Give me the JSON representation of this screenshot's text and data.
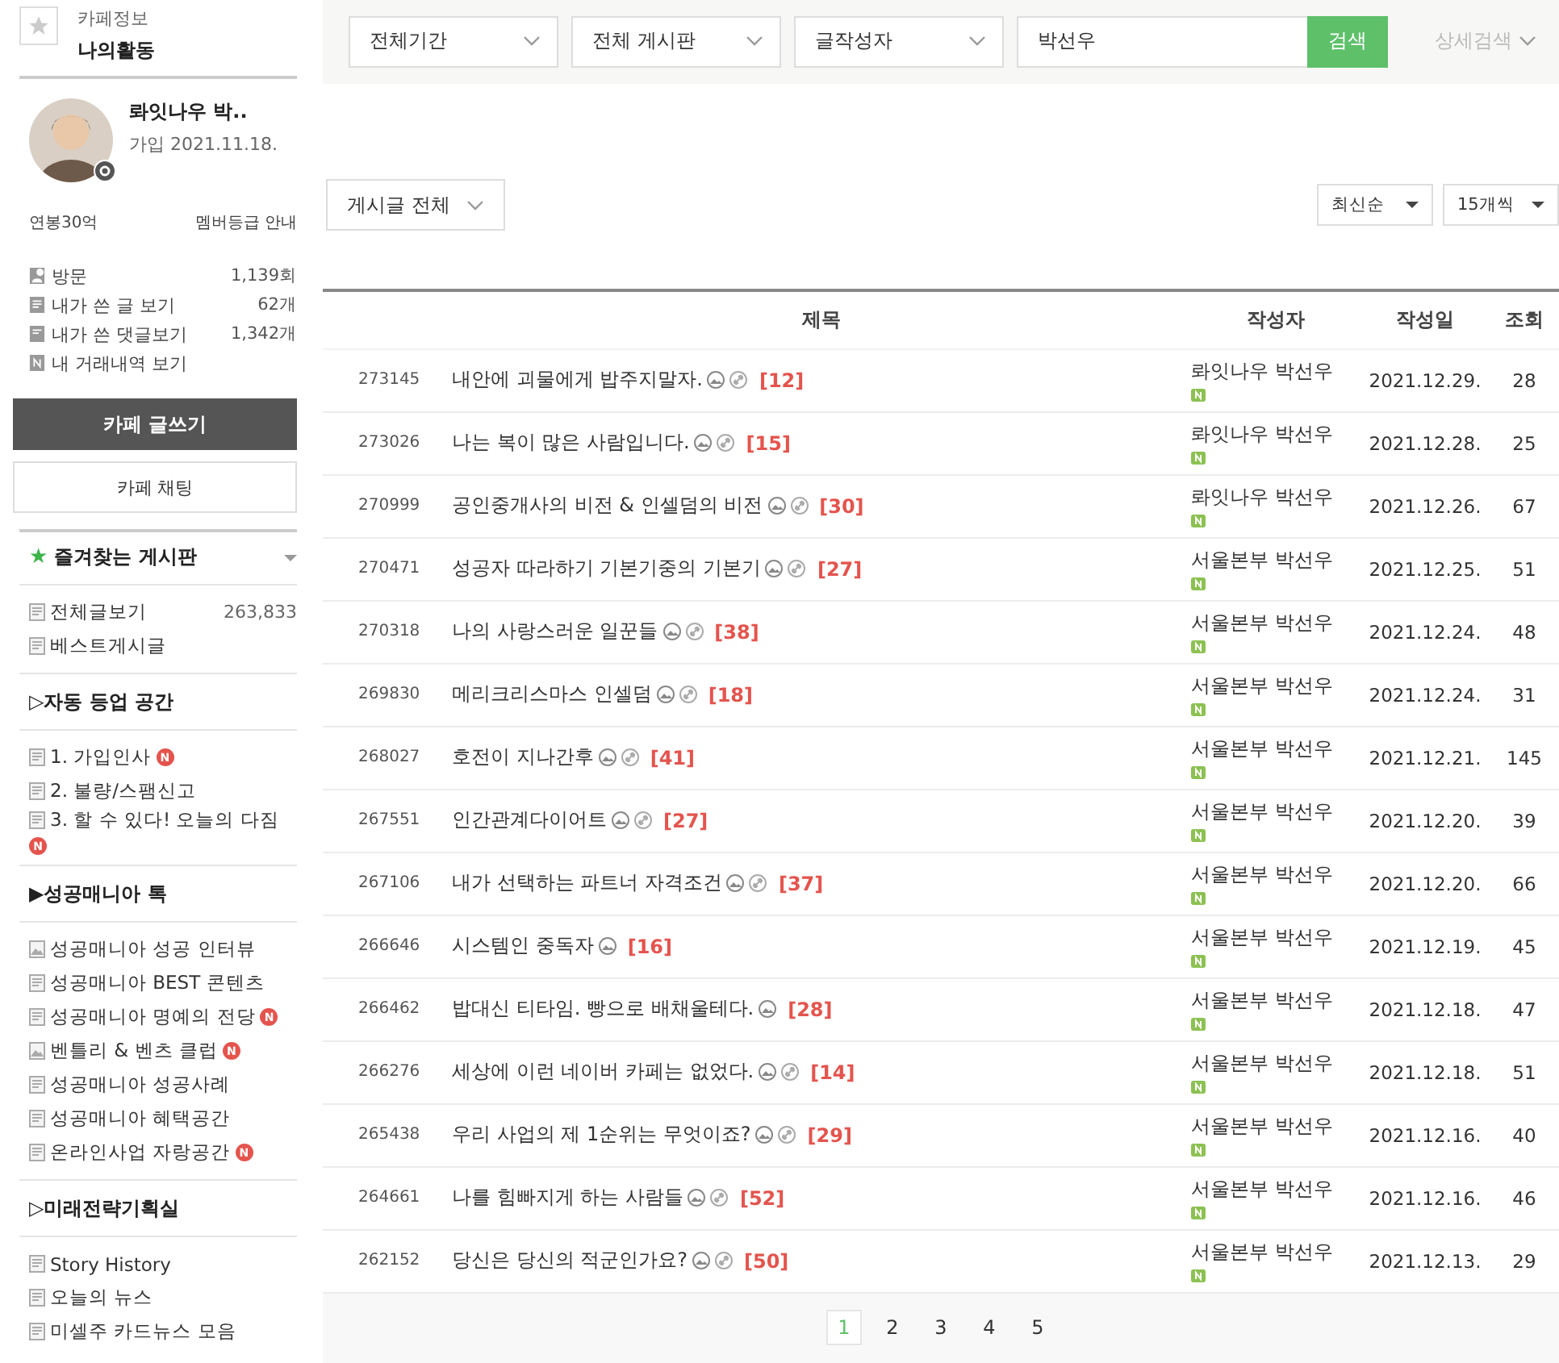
{
  "sidebar": {
    "cafe_info": "카페정보",
    "my_activity": "나의활동",
    "profile": {
      "nickname": "롸잇나우 박..",
      "joined": "가입 2021.11.18.",
      "grade": "연봉30억",
      "grade_guide": "멤버등급 안내"
    },
    "stats": [
      {
        "kind": "visit",
        "label": "방문",
        "value": "1,139회"
      },
      {
        "kind": "post",
        "label": "내가 쓴 글 보기",
        "value": "62개"
      },
      {
        "kind": "comment",
        "label": "내가 쓴 댓글보기",
        "value": "1,342개"
      },
      {
        "kind": "trade",
        "label": "내 거래내역 보기"
      }
    ],
    "write_button": "카페 글쓰기",
    "chat_button": "카페 채팅",
    "favorites": {
      "star": "★",
      "title": "즐겨찾는 게시판"
    },
    "sections": [
      {
        "items": [
          {
            "kind": "doc",
            "label": "전체글보기",
            "count": "263,833",
            "new": false
          },
          {
            "kind": "doc",
            "label": "베스트게시글",
            "new": false
          }
        ]
      },
      {
        "title": "▷자동 등업 공간",
        "items": [
          {
            "kind": "doc",
            "label": "1. 가입인사",
            "new": true,
            "badge": "N"
          },
          {
            "kind": "doc",
            "label": "2. 불량/스팸신고",
            "new": false
          },
          {
            "kind": "doc",
            "label": "3. 할 수 있다! 오늘의 다짐",
            "new": true,
            "badge": "N"
          }
        ]
      },
      {
        "title": "▶성공매니아 톡",
        "items": [
          {
            "kind": "image",
            "label": "성공매니아 성공 인터뷰",
            "new": false
          },
          {
            "kind": "doc",
            "label": "성공매니아 BEST 콘텐츠",
            "new": false
          },
          {
            "kind": "doc",
            "label": "성공매니아 명예의 전당",
            "new": true,
            "badge": "N"
          },
          {
            "kind": "image",
            "label": "벤틀리 & 벤츠 클럽",
            "new": true,
            "badge": "N"
          },
          {
            "kind": "doc",
            "label": "성공매니아 성공사례",
            "new": false
          },
          {
            "kind": "doc",
            "label": "성공매니아 혜택공간",
            "new": false
          },
          {
            "kind": "doc",
            "label": "온라인사업 자랑공간",
            "new": true,
            "badge": "N"
          }
        ]
      },
      {
        "title": "▷미래전략기획실",
        "items": [
          {
            "kind": "doc",
            "label": "Story History",
            "new": false
          },
          {
            "kind": "doc",
            "label": "오늘의 뉴스",
            "new": false
          },
          {
            "kind": "doc",
            "label": "미셀주 카드뉴스 모음",
            "new": false
          }
        ]
      }
    ]
  },
  "search": {
    "period": "전체기간",
    "board": "전체 게시판",
    "type": "글작성자",
    "value": "박선우",
    "button": "검색",
    "advanced": "상세검색"
  },
  "filter": "게시글 전체",
  "sort": "최신순",
  "per_page": "15개씩",
  "table": {
    "columns": [
      "제목",
      "작성자",
      "작성일",
      "조회"
    ],
    "rows": [
      {
        "id": "273145",
        "title": "내안에 괴물에게 밥주지말자.",
        "link": true,
        "comments": "[12]",
        "author": "롸잇나우 박선우",
        "date": "2021.12.29.",
        "views": "28"
      },
      {
        "id": "273026",
        "title": "나는 복이 많은 사람입니다.",
        "link": true,
        "comments": "[15]",
        "author": "롸잇나우 박선우",
        "date": "2021.12.28.",
        "views": "25"
      },
      {
        "id": "270999",
        "title": "공인중개사의 비전 & 인셀덤의 비전",
        "link": true,
        "comments": "[30]",
        "author": "롸잇나우 박선우",
        "date": "2021.12.26.",
        "views": "67"
      },
      {
        "id": "270471",
        "title": "성공자 따라하기 기본기중의 기본기",
        "link": true,
        "comments": "[27]",
        "author": "서울본부 박선우",
        "date": "2021.12.25.",
        "views": "51"
      },
      {
        "id": "270318",
        "title": "나의 사랑스러운 일꾼들",
        "link": true,
        "comments": "[38]",
        "author": "서울본부 박선우",
        "date": "2021.12.24.",
        "views": "48"
      },
      {
        "id": "269830",
        "title": "메리크리스마스 인셀덤",
        "link": true,
        "comments": "[18]",
        "author": "서울본부 박선우",
        "date": "2021.12.24.",
        "views": "31"
      },
      {
        "id": "268027",
        "title": "호전이 지나간후",
        "link": true,
        "comments": "[41]",
        "author": "서울본부 박선우",
        "date": "2021.12.21.",
        "views": "145"
      },
      {
        "id": "267551",
        "title": "인간관계다이어트",
        "link": true,
        "comments": "[27]",
        "author": "서울본부 박선우",
        "date": "2021.12.20.",
        "views": "39"
      },
      {
        "id": "267106",
        "title": "내가 선택하는 파트너 자격조건",
        "link": true,
        "comments": "[37]",
        "author": "서울본부 박선우",
        "date": "2021.12.20.",
        "views": "66"
      },
      {
        "id": "266646",
        "title": "시스템인 중독자",
        "link": false,
        "comments": "[16]",
        "author": "서울본부 박선우",
        "date": "2021.12.19.",
        "views": "45"
      },
      {
        "id": "266462",
        "title": "밥대신 티타임. 빵으로 배채울테다.",
        "link": false,
        "comments": "[28]",
        "author": "서울본부 박선우",
        "date": "2021.12.18.",
        "views": "47"
      },
      {
        "id": "266276",
        "title": "세상에 이런 네이버 카페는 없었다.",
        "link": true,
        "comments": "[14]",
        "author": "서울본부 박선우",
        "date": "2021.12.18.",
        "views": "51"
      },
      {
        "id": "265438",
        "title": "우리 사업의 제 1순위는 무엇이죠?",
        "link": true,
        "comments": "[29]",
        "author": "서울본부 박선우",
        "date": "2021.12.16.",
        "views": "40"
      },
      {
        "id": "264661",
        "title": "나를 힘빠지게 하는 사람들",
        "link": true,
        "comments": "[52]",
        "author": "서울본부 박선우",
        "date": "2021.12.16.",
        "views": "46"
      },
      {
        "id": "262152",
        "title": "당신은 당신의 적군인가요?",
        "link": true,
        "comments": "[50]",
        "author": "서울본부 박선우",
        "date": "2021.12.13.",
        "views": "29"
      }
    ]
  },
  "pagination": [
    {
      "label": "1",
      "selected": true
    },
    {
      "label": "2",
      "selected": false
    },
    {
      "label": "3",
      "selected": false
    },
    {
      "label": "4",
      "selected": false
    },
    {
      "label": "5",
      "selected": false
    }
  ]
}
